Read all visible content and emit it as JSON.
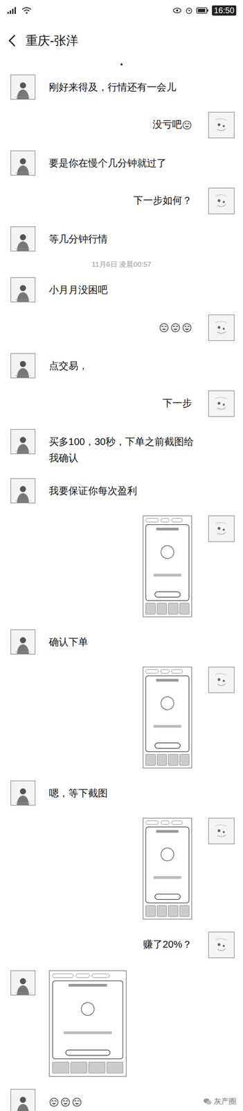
{
  "status_bar": {
    "time": "16:50"
  },
  "header": {
    "title": "重庆-张洋"
  },
  "messages": [
    {
      "kind": "text",
      "from": "them",
      "text": "刚好来得及，行情还有一会儿",
      "emoji": 0
    },
    {
      "kind": "text",
      "from": "me",
      "text": "没亏吧",
      "emoji": 1
    },
    {
      "kind": "text",
      "from": "them",
      "text": "要是你在慢个几分钟就过了",
      "emoji": 0
    },
    {
      "kind": "text",
      "from": "me",
      "text": "下一步如何？",
      "emoji": 0
    },
    {
      "kind": "text",
      "from": "them",
      "text": "等几分钟行情",
      "emoji": 0
    },
    {
      "kind": "time",
      "text": "11月6日 凌晨00:57"
    },
    {
      "kind": "text",
      "from": "them",
      "text": "小月月没困吧",
      "emoji": 0
    },
    {
      "kind": "emoji",
      "from": "me",
      "emoji": 3
    },
    {
      "kind": "text",
      "from": "them",
      "text": "点交易，",
      "emoji": 0
    },
    {
      "kind": "text",
      "from": "me",
      "text": "下一步",
      "emoji": 0
    },
    {
      "kind": "text",
      "from": "them",
      "text": "买多100，30秒，下单之前截图给我确认",
      "emoji": 0
    },
    {
      "kind": "text",
      "from": "them",
      "text": "我要保证你每次盈利",
      "emoji": 0
    },
    {
      "kind": "image",
      "from": "me"
    },
    {
      "kind": "text",
      "from": "them",
      "text": "确认下单",
      "emoji": 0
    },
    {
      "kind": "image",
      "from": "me"
    },
    {
      "kind": "text",
      "from": "them",
      "text": "嗯，等下截图",
      "emoji": 0
    },
    {
      "kind": "image",
      "from": "me"
    },
    {
      "kind": "text",
      "from": "me",
      "text": "赚了20%？",
      "emoji": 0
    },
    {
      "kind": "image",
      "from": "them"
    },
    {
      "kind": "emoji",
      "from": "them",
      "emoji": 3
    }
  ],
  "watermark": "灰产圈"
}
